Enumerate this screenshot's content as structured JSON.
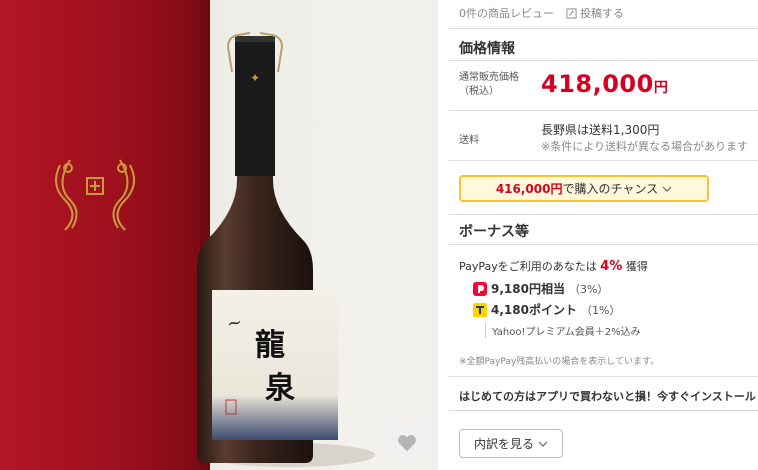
{
  "reviews": {
    "count_label": "0件の商品レビュー",
    "post_label": "投稿する"
  },
  "price_info": {
    "title": "価格情報",
    "regular_label": "通常販売価格（税込）",
    "price": "418,000",
    "yen": "円",
    "shipping_label": "送料",
    "shipping_main": "長野県は送料1,300円",
    "shipping_note": "※条件により送料が異なる場合があります"
  },
  "chance": {
    "amount": "416,000円",
    "label": "で購入のチャンス"
  },
  "bonus": {
    "title": "ボーナス等",
    "intro": "PayPayをご利用のあなたは",
    "percent": "4%",
    "intro_suffix": "獲得",
    "paypay_amount": "9,180円相当",
    "paypay_rate": "（3%）",
    "tpoint_amount": "4,180ポイント",
    "tpoint_rate": "（1%）",
    "premium": "Yahoo!プレミアム会員＋2%込み",
    "note": "※全額PayPay残高払いの場合を表示しています。"
  },
  "app_banner": "はじめての方はアプリで買わないと損！今すぐインストール",
  "breakdown_button": "内訳を見る",
  "bottle_label_text": "龍泉",
  "colors": {
    "price_red": "#d70021",
    "box_red": "#a3111e",
    "chance_border": "#f6c33a",
    "paypay_red": "#ff0033"
  }
}
